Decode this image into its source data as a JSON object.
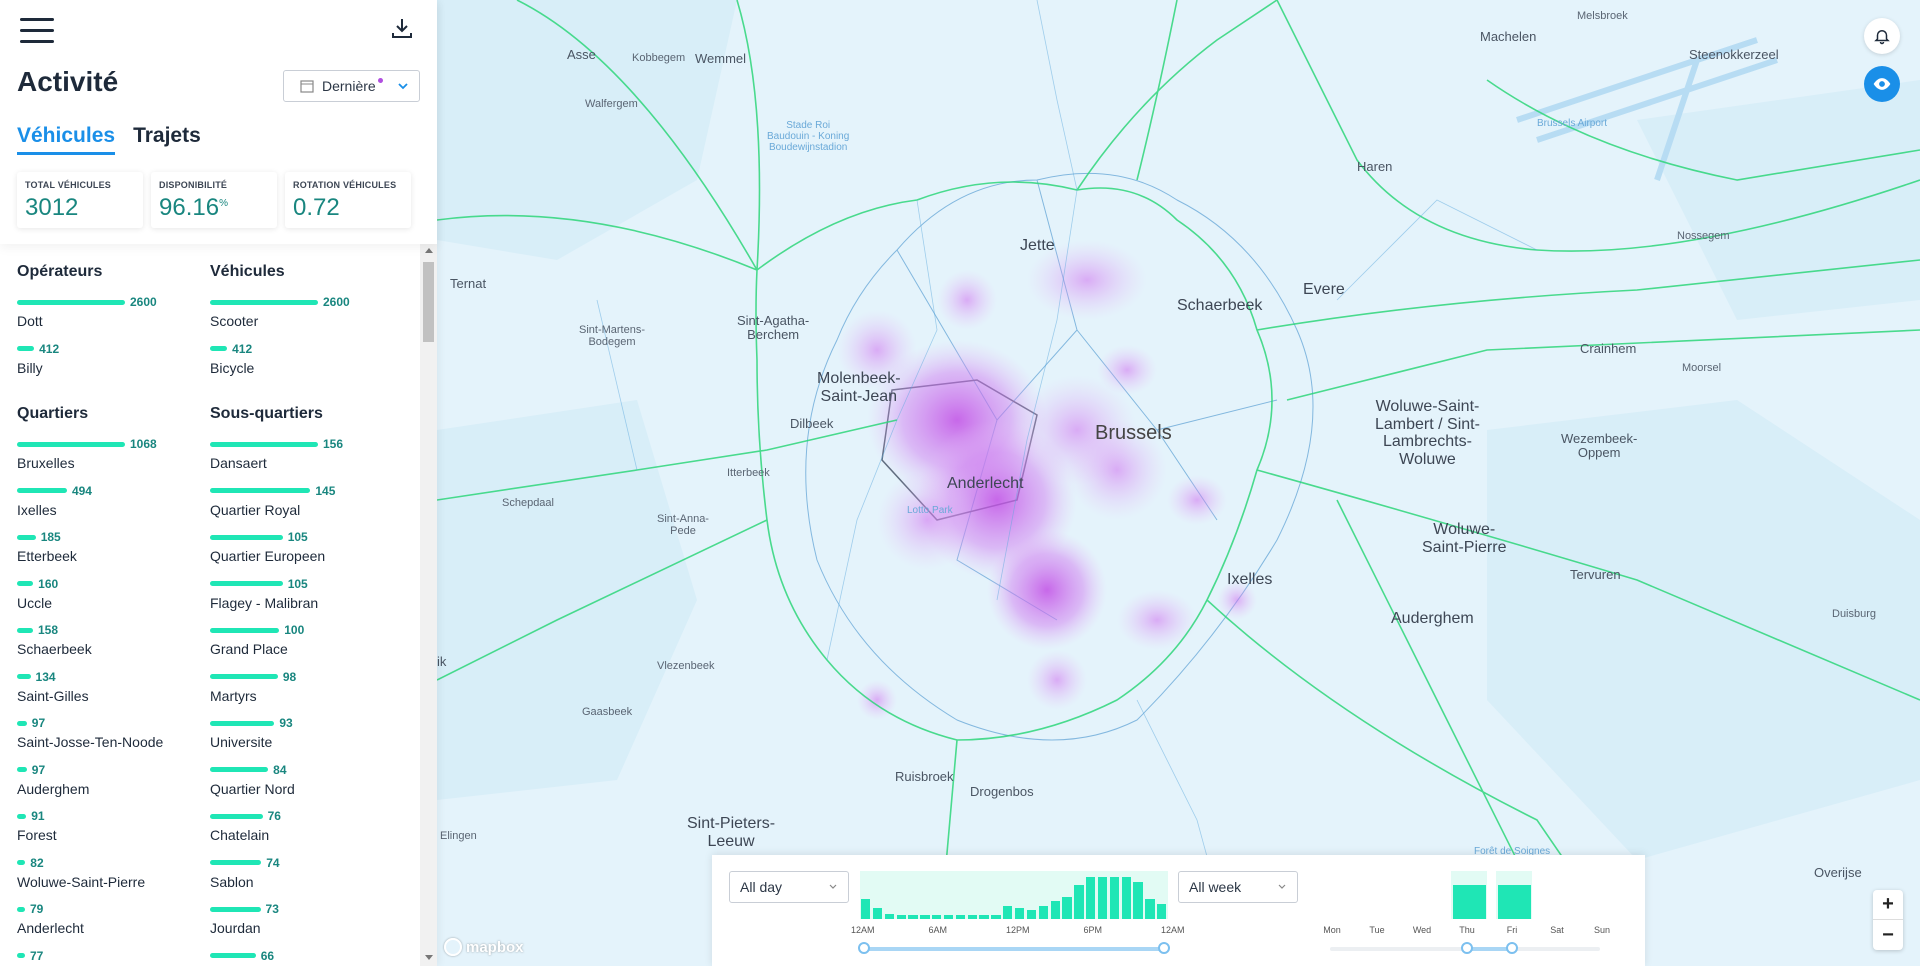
{
  "header": {
    "title": "Activité",
    "period_label": "Dernière",
    "tabs": [
      {
        "label": "Véhicules",
        "active": true
      },
      {
        "label": "Trajets",
        "active": false
      }
    ]
  },
  "kpis": [
    {
      "label": "TOTAL VÉHICULES",
      "value": "3012",
      "unit": ""
    },
    {
      "label": "DISPONIBILITÉ",
      "value": "96.16",
      "unit": "%"
    },
    {
      "label": "ROTATION VÉHICULES",
      "value": "0.72",
      "unit": ""
    }
  ],
  "operators": {
    "title": "Opérateurs",
    "items": [
      {
        "name": "Dott",
        "value": 2600
      },
      {
        "name": "Billy",
        "value": 412
      }
    ]
  },
  "vehicles": {
    "title": "Véhicules",
    "items": [
      {
        "name": "Scooter",
        "value": 2600
      },
      {
        "name": "Bicycle",
        "value": 412
      }
    ]
  },
  "quartiers": {
    "title": "Quartiers",
    "items": [
      {
        "name": "Bruxelles",
        "value": 1068
      },
      {
        "name": "Ixelles",
        "value": 494
      },
      {
        "name": "Etterbeek",
        "value": 185
      },
      {
        "name": "Uccle",
        "value": 160
      },
      {
        "name": "Schaerbeek",
        "value": 158
      },
      {
        "name": "Saint-Gilles",
        "value": 134
      },
      {
        "name": "Saint-Josse-Ten-Noode",
        "value": 97
      },
      {
        "name": "Auderghem",
        "value": 97
      },
      {
        "name": "Forest",
        "value": 91
      },
      {
        "name": "Woluwe-Saint-Pierre",
        "value": 82
      },
      {
        "name": "Anderlecht",
        "value": 79
      },
      {
        "name": "",
        "value": 77
      }
    ]
  },
  "sous_quartiers": {
    "title": "Sous-quartiers",
    "items": [
      {
        "name": "Dansaert",
        "value": 156
      },
      {
        "name": "Quartier Royal",
        "value": 145
      },
      {
        "name": "Quartier Europeen",
        "value": 105
      },
      {
        "name": "Flagey - Malibran",
        "value": 105
      },
      {
        "name": "Grand Place",
        "value": 100
      },
      {
        "name": "Martyrs",
        "value": 98
      },
      {
        "name": "Universite",
        "value": 93
      },
      {
        "name": "Quartier Nord",
        "value": 84
      },
      {
        "name": "Chatelain",
        "value": 76
      },
      {
        "name": "Sablon",
        "value": 74
      },
      {
        "name": "Jourdan",
        "value": 73
      },
      {
        "name": "",
        "value": 66
      }
    ]
  },
  "map": {
    "labels": [
      {
        "text": "Asse",
        "cls": ""
      },
      {
        "text": "Kobbegem",
        "cls": "small"
      },
      {
        "text": "Wemmel",
        "cls": ""
      },
      {
        "text": "Walfergem",
        "cls": "small"
      },
      {
        "text": "Melsbroek",
        "cls": "small"
      },
      {
        "text": "Machelen",
        "cls": ""
      },
      {
        "text": "Steenokkerzeel",
        "cls": ""
      },
      {
        "text": "Haren",
        "cls": ""
      },
      {
        "text": "Nossegem",
        "cls": "small"
      },
      {
        "text": "Ternat",
        "cls": ""
      },
      {
        "text": "Jette",
        "cls": "big"
      },
      {
        "text": "Sint-Martens-\nBodegem",
        "cls": "small"
      },
      {
        "text": "Sint-Agatha-\nBerchem",
        "cls": ""
      },
      {
        "text": "Schaerbeek",
        "cls": "big"
      },
      {
        "text": "Evere",
        "cls": "big"
      },
      {
        "text": "Crainhem",
        "cls": ""
      },
      {
        "text": "Moorsel",
        "cls": "small"
      },
      {
        "text": "Molenbeek-\nSaint-Jean",
        "cls": "big"
      },
      {
        "text": "Brussels",
        "cls": "city"
      },
      {
        "text": "Woluwe-Saint-\nLambert / Sint-\nLambrechts-\nWoluwe",
        "cls": "big"
      },
      {
        "text": "Dilbeek",
        "cls": ""
      },
      {
        "text": "Wezembeek-\nOppem",
        "cls": ""
      },
      {
        "text": "Itterbeek",
        "cls": "small"
      },
      {
        "text": "Anderlecht",
        "cls": "big"
      },
      {
        "text": "Schepdaal",
        "cls": "small"
      },
      {
        "text": "Sint-Anna-\nPede",
        "cls": "small"
      },
      {
        "text": "Woluwe-\nSaint-Pierre",
        "cls": "big"
      },
      {
        "text": "Ixelles",
        "cls": "big"
      },
      {
        "text": "Tervuren",
        "cls": ""
      },
      {
        "text": "Auderghem",
        "cls": "big"
      },
      {
        "text": "Duisburg",
        "cls": "small"
      },
      {
        "text": "Vlezenbeek",
        "cls": "small"
      },
      {
        "text": "Gaasbeek",
        "cls": "small"
      },
      {
        "text": "Ruisbroek",
        "cls": ""
      },
      {
        "text": "Drogenbos",
        "cls": ""
      },
      {
        "text": "Sint-Pieters-\nLeeuw",
        "cls": "big"
      },
      {
        "text": "Elingen",
        "cls": "small"
      },
      {
        "text": "Overijse",
        "cls": ""
      },
      {
        "text": "Stade Roi\nBaudouin - Koning\nBoudewijnstadion",
        "cls": "blue"
      },
      {
        "text": "Lotto Park",
        "cls": "blue"
      },
      {
        "text": "Brussels Airport",
        "cls": "blue"
      },
      {
        "text": "Forêt de Soignes",
        "cls": "blue"
      },
      {
        "text": "ik",
        "cls": ""
      }
    ],
    "attribution": "mapbox",
    "colors": {
      "water_bg": "#e4f3fb",
      "road": "#2ed67a",
      "heat": "#c85ae8",
      "accent": "#1a8fe8"
    }
  },
  "time_filter": {
    "day_range_label": "All day",
    "week_range_label": "All week",
    "hour_ticks": [
      "12AM",
      "6AM",
      "12PM",
      "6PM",
      "12AM"
    ],
    "hourly_activity": [
      0.45,
      0.25,
      0.12,
      0.1,
      0.08,
      0.08,
      0.08,
      0.1,
      0.08,
      0.08,
      0.08,
      0.08,
      0.3,
      0.25,
      0.2,
      0.3,
      0.4,
      0.5,
      0.78,
      0.95,
      0.95,
      0.95,
      0.95,
      0.85,
      0.45,
      0.35
    ],
    "days": [
      "Mon",
      "Tue",
      "Wed",
      "Thu",
      "Fri",
      "Sat",
      "Sun"
    ],
    "day_activity": [
      0,
      0,
      0,
      0.95,
      0.95,
      0,
      0
    ],
    "hour_selection": [
      0,
      1
    ],
    "day_selection": [
      3,
      4
    ]
  }
}
